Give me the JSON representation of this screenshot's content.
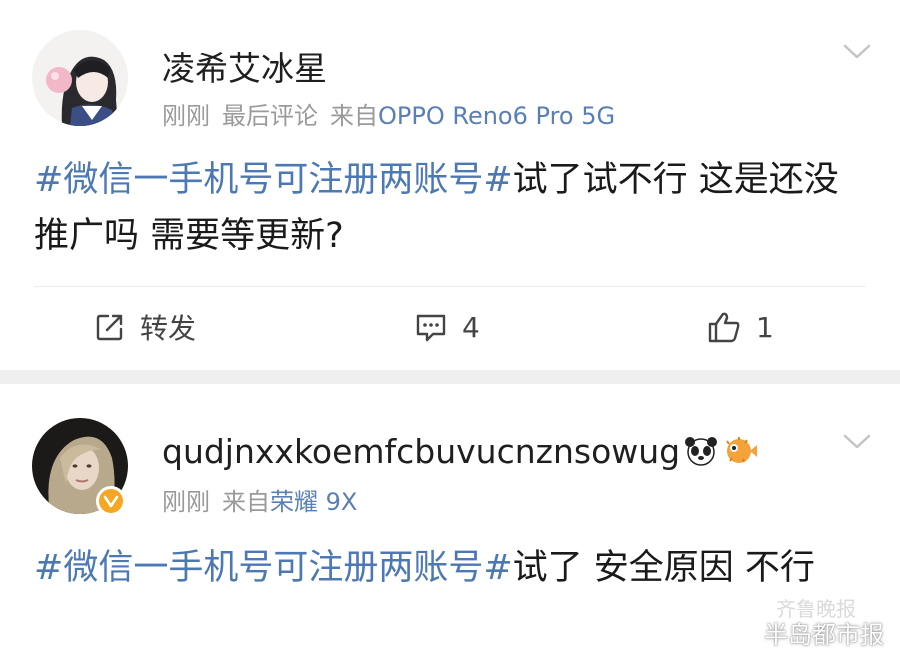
{
  "posts": [
    {
      "username": "凌希艾冰星",
      "time": "刚刚",
      "tag": "最后评论",
      "source_prefix": "来自",
      "source_device": "OPPO Reno6 Pro 5G",
      "hashtag": "#微信一手机号可注册两账号#",
      "text": "试了试不行 这是还没推广吗 需要等更新?",
      "actions": {
        "repost_label": "转发",
        "comments": "4",
        "likes": "1"
      }
    },
    {
      "username": "qudjnxxkoemfcbuvucnznsowug",
      "time": "刚刚",
      "source_prefix": "来自",
      "source_device": "荣耀 9X",
      "hashtag": "#微信一手机号可注册两账号#",
      "text": "试了 安全原因 不行"
    }
  ],
  "watermark": {
    "text": "半岛都市报",
    "ghost_text": "齐鲁晚报"
  },
  "colors": {
    "hashtag": "#4c78b4",
    "meta_gray": "#9a9a9a",
    "separator": "#efefef",
    "verified_badge": "#f5a623"
  },
  "icons": [
    "chevron-down-icon",
    "repost-icon",
    "comment-icon",
    "like-icon",
    "panda-emoji-icon",
    "pufferfish-emoji-icon",
    "verified-badge-icon",
    "wechat-icon"
  ]
}
